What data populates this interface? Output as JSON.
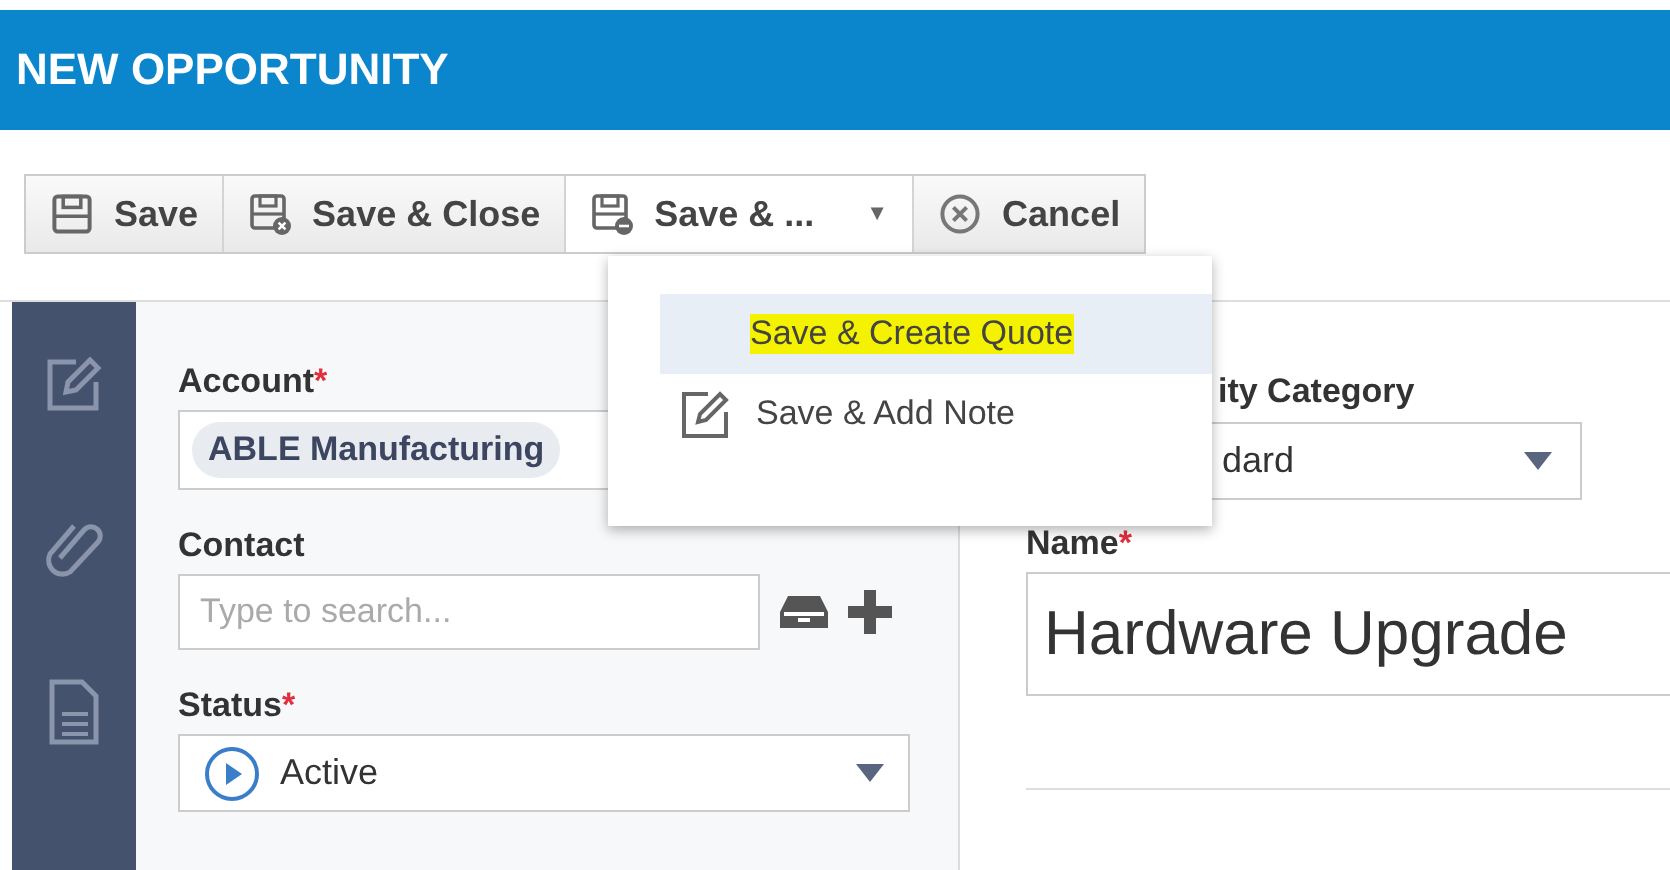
{
  "header": {
    "title": "NEW OPPORTUNITY"
  },
  "toolbar": [
    {
      "label": "Save",
      "kind": "save",
      "expanded": false
    },
    {
      "label": "Save & Close",
      "kind": "save-close",
      "expanded": false
    },
    {
      "label": "Save & ...",
      "kind": "save-more",
      "expanded": true,
      "caret": "▼"
    },
    {
      "label": "Cancel",
      "kind": "cancel",
      "expanded": false
    }
  ],
  "menu": {
    "items": [
      {
        "label": "Save & Create Quote",
        "kind": "plain",
        "selected": true
      },
      {
        "label": "Save & Add Note",
        "kind": "note",
        "selected": false
      }
    ]
  },
  "form": {
    "account": {
      "label": "Account",
      "required_mark": "*",
      "value": "ABLE Manufacturing"
    },
    "contact": {
      "label": "Contact",
      "placeholder": "Type to search..."
    },
    "status": {
      "label": "Status",
      "required_mark": "*",
      "value": "Active"
    },
    "category": {
      "label": "ity Category",
      "value": "dard"
    },
    "name": {
      "label": "Name",
      "required_mark": "*",
      "value": "Hardware Upgrade"
    }
  }
}
